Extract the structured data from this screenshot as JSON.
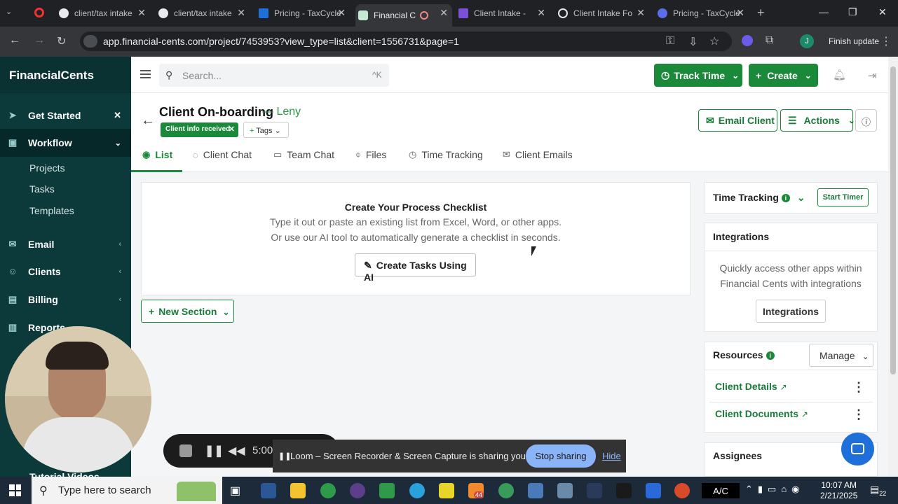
{
  "browser": {
    "tabs": [
      {
        "label": "client/tax intake",
        "icon": "github-icon",
        "active": false
      },
      {
        "label": "client/tax intake",
        "icon": "github-icon",
        "active": false
      },
      {
        "label": "Pricing - TaxCycle",
        "icon": "taxcycle-icon",
        "active": false
      },
      {
        "label": "Financial Cents",
        "icon": "financialcents-icon",
        "active": true
      },
      {
        "label": "Client Intake - ",
        "icon": "form-icon",
        "active": false
      },
      {
        "label": "Client Intake Fo",
        "icon": "chatgpt-icon",
        "active": false
      },
      {
        "label": "Pricing - TaxCycle",
        "icon": "taxcycle-icon",
        "active": false
      }
    ],
    "url": "app.financial-cents.com/project/7453953?view_type=list&client=1556731&page=1",
    "profile_initial": "J",
    "finish_update": "Finish update"
  },
  "sidebar": {
    "brand": "FinancialCents",
    "items": [
      {
        "label": "Get Started",
        "icon": "rocket-icon"
      },
      {
        "label": "Workflow",
        "icon": "briefcase-icon"
      },
      {
        "label": "Email",
        "icon": "mail-icon"
      },
      {
        "label": "Clients",
        "icon": "users-icon"
      },
      {
        "label": "Billing",
        "icon": "billing-icon"
      },
      {
        "label": "Reports",
        "icon": "chart-icon"
      }
    ],
    "workflow_subitems": [
      "Projects",
      "Tasks",
      "Templates"
    ],
    "tutorial": "Tutorial Videos"
  },
  "topbar": {
    "search_placeholder": "Search...",
    "search_shortcut": "^K",
    "track_time": "Track Time",
    "create": "Create"
  },
  "project": {
    "title": "Client On-boarding",
    "client_suffix": "— Leny",
    "status_badge": "Client info received",
    "tags_label": "Tags",
    "email_client": "Email Client",
    "actions": "Actions"
  },
  "subtabs": [
    {
      "label": "List",
      "active": true
    },
    {
      "label": "Client Chat"
    },
    {
      "label": "Team Chat"
    },
    {
      "label": "Files"
    },
    {
      "label": "Time Tracking"
    },
    {
      "label": "Client Emails"
    }
  ],
  "checklist": {
    "title": "Create Your Process Checklist",
    "line1": "Type it out or paste an existing list from Excel, Word, or other apps.",
    "line2": "Or use our AI tool to automatically generate a checklist in seconds.",
    "ai_button": "Create Tasks Using AI",
    "new_section": "New Section"
  },
  "right": {
    "time_tracking": "Time Tracking",
    "start_timer": "Start Timer",
    "integrations_title": "Integrations",
    "integrations_text1": "Quickly access other apps within",
    "integrations_text2": "Financial Cents with integrations",
    "integrations_button": "Integrations",
    "resources_title": "Resources",
    "manage": "Manage",
    "resource_links": [
      "Client Details",
      "Client Documents"
    ],
    "assignees": "Assignees"
  },
  "loom": {
    "timer": "5:00",
    "share_text": "Loom – Screen Recorder & Screen Capture is sharing your screen.",
    "stop_sharing": "Stop sharing",
    "hide": "Hide"
  },
  "taskbar": {
    "search_placeholder": "Type here to search",
    "notif_badge": "44",
    "lang": "A/C",
    "time": "10:07 AM",
    "date": "2/21/2025",
    "notif_count": "22"
  }
}
